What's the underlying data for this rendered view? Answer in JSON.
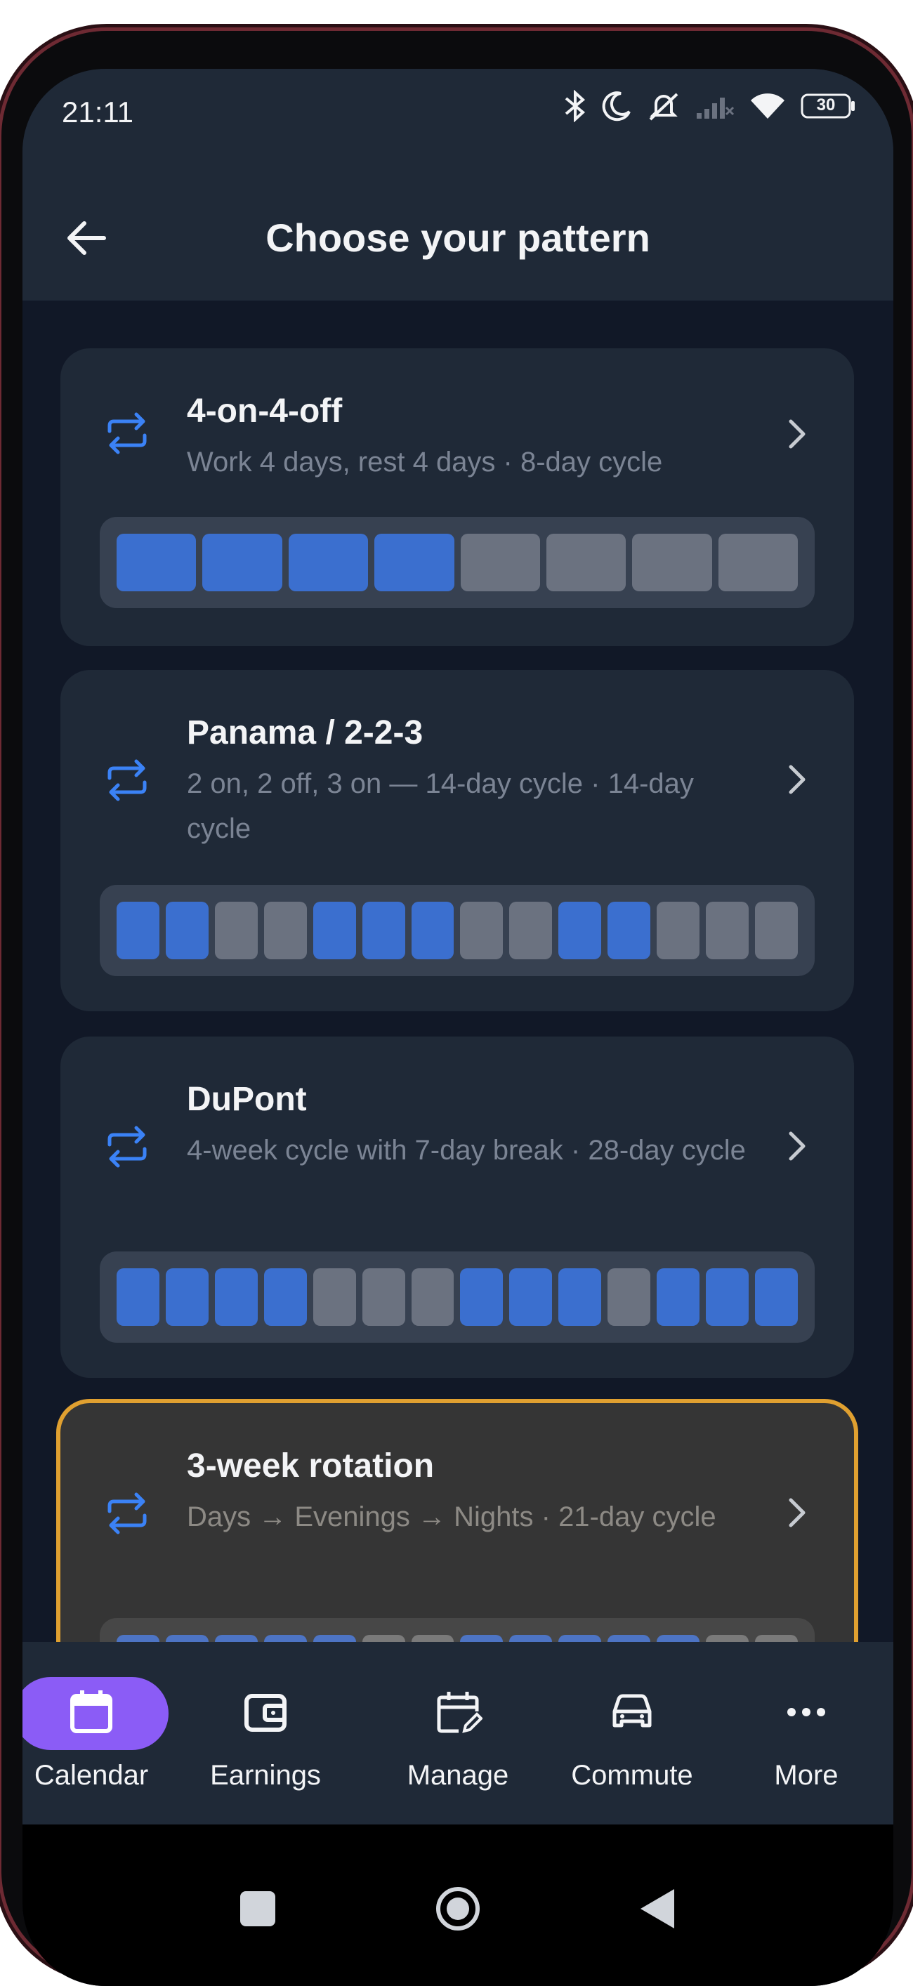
{
  "status_bar": {
    "time": "21:11",
    "battery": "30",
    "icons": [
      "bluetooth-icon",
      "moon-icon",
      "mute-icon",
      "signal-icon",
      "wifi-icon",
      "battery-icon"
    ]
  },
  "header": {
    "title": "Choose your pattern",
    "back_icon": "arrow-left-icon"
  },
  "colors": {
    "work_day": "#3b6fcf",
    "off_day": "#6b7280",
    "accent_selected": "#e0a030",
    "nav_active": "#8b5cf6"
  },
  "patterns": [
    {
      "name": "4-on-4-off",
      "description": "Work 4 days, rest 4 days · 8-day cycle",
      "days": [
        1,
        1,
        1,
        1,
        0,
        0,
        0,
        0
      ]
    },
    {
      "name": "Panama / 2-2-3",
      "description": "2 on, 2 off, 3 on — 14-day cycle · 14-day cycle",
      "days": [
        1,
        1,
        0,
        0,
        1,
        1,
        1,
        0,
        0,
        1,
        1,
        0,
        0,
        0
      ]
    },
    {
      "name": "DuPont",
      "description": "4-week cycle with 7-day break · 28-day cycle",
      "days": [
        1,
        1,
        1,
        1,
        0,
        0,
        0,
        1,
        1,
        1,
        0,
        1,
        1,
        1
      ]
    },
    {
      "name": "3-week rotation",
      "description": "Days → Evenings → Nights · 21-day cycle",
      "days": [
        1,
        1,
        1,
        1,
        1,
        0,
        0,
        1,
        1,
        1,
        1,
        1,
        0,
        0
      ],
      "selected": true
    }
  ],
  "bottom_nav": [
    {
      "label": "Calendar",
      "icon": "calendar-icon",
      "active": true
    },
    {
      "label": "Earnings",
      "icon": "wallet-icon",
      "active": false
    },
    {
      "label": "Manage",
      "icon": "calendar-edit-icon",
      "active": false
    },
    {
      "label": "Commute",
      "icon": "car-icon",
      "active": false
    },
    {
      "label": "More",
      "icon": "more-dots-icon",
      "active": false
    }
  ]
}
